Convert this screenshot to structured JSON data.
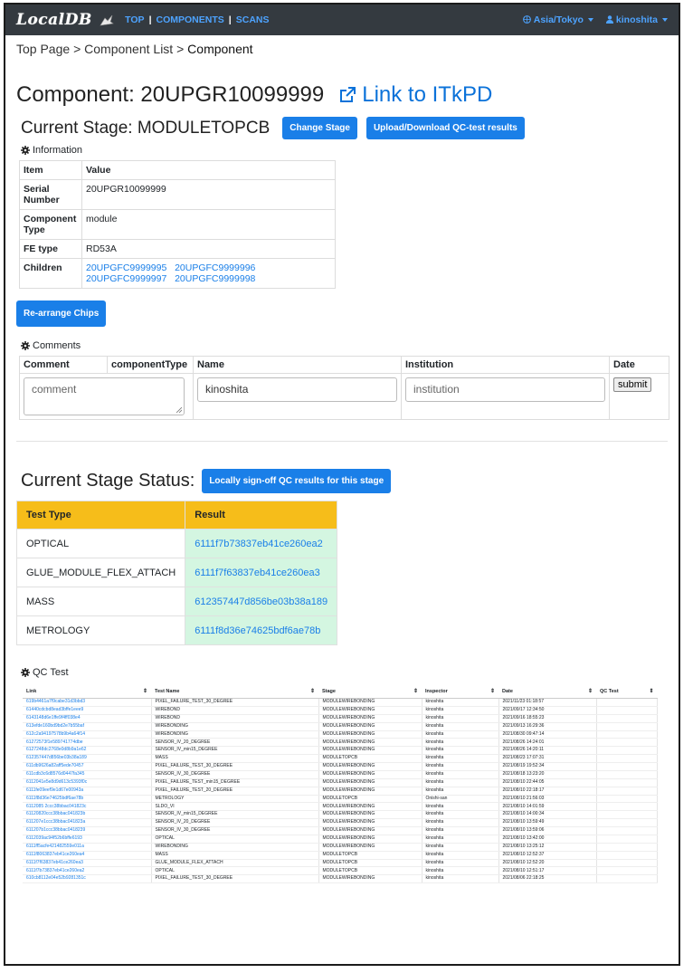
{
  "nav": {
    "brand": "LocalDB",
    "links": [
      "TOP",
      "COMPONENTS",
      "SCANS"
    ],
    "timezone": "Asia/Tokyo",
    "user": "kinoshita"
  },
  "breadcrumb": {
    "top": "Top Page",
    "list": "Component List",
    "current": "Component",
    "sep": ">"
  },
  "component": {
    "title": "Component: 20UPGR10099999",
    "itkpd_link": "Link to ITkPD"
  },
  "stage": {
    "title": "Current Stage: MODULETOPCB",
    "change_button": "Change Stage",
    "upload_button": "Upload/Download QC-test results"
  },
  "information": {
    "label": "Information",
    "headers": [
      "Item",
      "Value"
    ],
    "rows": [
      {
        "item": "Serial Number",
        "value": "20UPGR10099999"
      },
      {
        "item": "Component Type",
        "value": "module"
      },
      {
        "item": "FE type",
        "value": "RD53A"
      }
    ],
    "children_label": "Children",
    "children": [
      "20UPGFC9999995",
      "20UPGFC9999996",
      "20UPGFC9999997",
      "20UPGFC9999998"
    ]
  },
  "rearrange_button": "Re-arrange Chips",
  "comments": {
    "label": "Comments",
    "headers": [
      "Comment",
      "componentType",
      "Name",
      "Institution",
      "Date"
    ],
    "comment_placeholder": "comment",
    "name_value": "kinoshita",
    "institution_placeholder": "institution",
    "submit_label": "submit"
  },
  "stage_status": {
    "title": "Current Stage Status:",
    "signoff_button": "Locally sign-off QC results for this stage",
    "headers": [
      "Test Type",
      "Result"
    ],
    "rows": [
      {
        "test": "OPTICAL",
        "result": "6111f7b73837eb41ce260ea2"
      },
      {
        "test": "GLUE_MODULE_FLEX_ATTACH",
        "result": "6111f7f63837eb41ce260ea3"
      },
      {
        "test": "MASS",
        "result": "612357447d856be03b38a189"
      },
      {
        "test": "METROLOGY",
        "result": "6111f8d36e74625bdf6ae78b"
      }
    ],
    "colors": {
      "header": "#f6bd1a",
      "result_bg": "#d4f6e1"
    }
  },
  "qc_test": {
    "label": "QC Test",
    "headers": [
      "Link",
      "Test Name",
      "Stage",
      "Inspector",
      "Date",
      "QC Test"
    ],
    "rows": [
      [
        "619b4461a7f9cabe31d3bbd3",
        "PIXEL_FAILURE_TEST_30_DEGREE",
        "MODULEWIREBONDING",
        "kinoshita",
        "2021/11/23 01:18:57"
      ],
      [
        "61440cdcbd8ead3bffe1eee9",
        "WIREBOND",
        "MODULEWIREBONDING",
        "kinoshita",
        "2021/09/17 12:34:50"
      ],
      [
        "6143148d6e1ffe9f4ff038e4",
        "WIREBOND",
        "MODULEWIREBONDING",
        "kinoshita",
        "2021/09/16 18:55:23"
      ],
      [
        "613efde160bd9bd2e7b55baf",
        "WIREBONDING",
        "MODULEWIREBONDING",
        "kinoshita",
        "2021/09/13 16:29:36"
      ],
      [
        "612c2a94197578b9b4a64f14",
        "WIREBONDING",
        "MODULEWIREBONDING",
        "kinoshita",
        "2021/08/30 09:47:14"
      ],
      [
        "61272573f1e589741774dbe",
        "SENSOR_IV_20_DEGREE",
        "MODULEWIREBONDING",
        "kinoshita",
        "2021/08/26 14:24:01"
      ],
      [
        "6127248dc2768e0d8b9a1e62",
        "SENSOR_IV_min15_DEGREE",
        "MODULEWIREBONDING",
        "kinoshita",
        "2021/08/26 14:20:11"
      ],
      [
        "612357447d856be03b38a189",
        "MASS",
        "MODULETOPCB",
        "kinoshita",
        "2021/08/23 17:07:31"
      ],
      [
        "611db9626a82aff5ede70457",
        "PIXEL_FAILURE_TEST_30_DEGREE",
        "MODULEWIREBONDING",
        "kinoshita",
        "2021/08/19 19:52:34"
      ],
      [
        "611cdb3c6d8576d0447fa345",
        "SENSOR_IV_30_DEGREE",
        "MODULEWIREBONDING",
        "kinoshita",
        "2021/08/18 13:23:20"
      ],
      [
        "6112041e5e8d9d613c5393f0c",
        "PIXEL_FAILURE_TEST_min15_DEGREE",
        "MODULEWIREBONDING",
        "kinoshita",
        "2021/08/10 22:44:05"
      ],
      [
        "6111fe09eef9e1d67e00943a",
        "PIXEL_FAILURE_TEST_20_DEGREE",
        "MODULEWIREBONDING",
        "kinoshita",
        "2021/08/10 22:18:17"
      ],
      [
        "6111f8d36e74625bdf6ae78b",
        "METROLOGY",
        "MODULETOPCB",
        "Onishi-san",
        "2021/08/10 21:56:03"
      ],
      [
        "6112085 2ccc38bbac041823c",
        "SLDO_VI",
        "MODULEWIREBONDING",
        "kinoshita",
        "2021/08/10 14:01:59"
      ],
      [
        "61120820ccc38bbac041823b",
        "SENSOR_IV_min15_DEGREE",
        "MODULEWIREBONDING",
        "kinoshita",
        "2021/08/10 14:00:34"
      ],
      [
        "611207e1ccc38bbac041823a",
        "SENSOR_IV_20_DEGREE",
        "MODULEWIREBONDING",
        "kinoshita",
        "2021/08/10 13:59:49"
      ],
      [
        "611207b1ccc38bbac0418239",
        "SENSOR_IV_30_DEGREE",
        "MODULEWIREBONDING",
        "kinoshita",
        "2021/08/10 13:59:06"
      ],
      [
        "6112039ac94f52b6bffe6193",
        "OPTICAL",
        "MODULEWIREBONDING",
        "kinoshita",
        "2021/08/10 13:42:00"
      ],
      [
        "6111ff5acfe421482559e011a",
        "WIREBONDING",
        "MODULEWIREBONDING",
        "kinoshita",
        "2021/08/10 13:25:12"
      ],
      [
        "6111f8063837eb41ce260ea4",
        "MASS",
        "MODULETOPCB",
        "kinoshita",
        "2021/08/10 12:52:37"
      ],
      [
        "6111f7f63837eb41ce260ea3",
        "GLUE_MODULE_FLEX_ATTACH",
        "MODULETOPCB",
        "kinoshita",
        "2021/08/10 12:52:20"
      ],
      [
        "6111f7b73837eb41ce260ea2",
        "OPTICAL",
        "MODULETOPCB",
        "kinoshita",
        "2021/08/10 12:51:17"
      ],
      [
        "610cb8112e04e52b9281351c",
        "PIXEL_FAILURE_TEST_30_DEGREE",
        "MODULEWIREBONDING",
        "kinoshita",
        "2021/08/06 22:18:25"
      ]
    ]
  }
}
